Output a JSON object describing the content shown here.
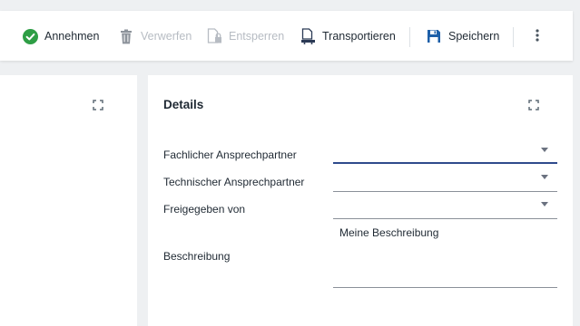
{
  "toolbar": {
    "accept_label": "Annehmen",
    "discard_label": "Verwerfen",
    "unlock_label": "Entsperren",
    "transport_label": "Transportieren",
    "save_label": "Speichern",
    "more_icon": "more-vertical-icon"
  },
  "colors": {
    "accept_green": "#2e9e45",
    "active_underline": "#2e4a8c",
    "disabled_text": "#b7bcc3",
    "save_blue": "#1d5fa8"
  },
  "details": {
    "title": "Details",
    "fields": [
      {
        "label": "Fachlicher Ansprechpartner",
        "value": ""
      },
      {
        "label": "Technischer Ansprechpartner",
        "value": ""
      },
      {
        "label": "Freigegeben von",
        "value": ""
      }
    ],
    "description_label": "Beschreibung",
    "description_value": "Meine Beschreibung"
  }
}
